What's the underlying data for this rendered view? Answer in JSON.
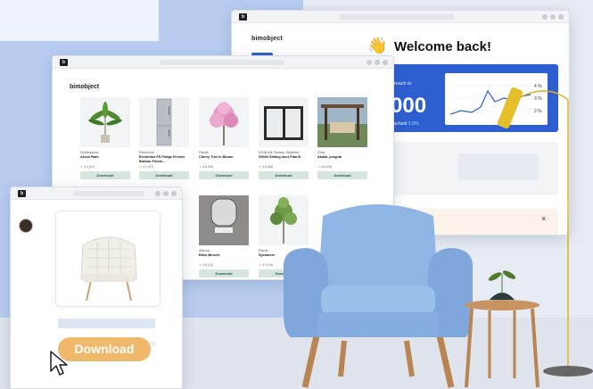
{
  "window_dashboard": {
    "logo": "bimobject",
    "greeting_emoji": "👋",
    "greeting": "Welcome back!",
    "stats": {
      "label": "al reach in",
      "value": "000",
      "sub_prefix": "reached ",
      "sub_pct": "3.8%"
    },
    "mini_chart_ticks": [
      "4 %",
      "3 %",
      "2 %"
    ],
    "close_icon": "×"
  },
  "window_catalog": {
    "logo": "bimobject",
    "products": [
      {
        "brand": "Gohleasons",
        "name": "Areca Palm",
        "rating": "4.2 (67)",
        "download": "Download",
        "thumb": "palm"
      },
      {
        "brand": "Electrolux",
        "name": "Electrolux FS Fridge Freezer Bottom Freeze...",
        "rating": "4.1 (67)",
        "download": "Download",
        "thumb": "fridge"
      },
      {
        "brand": "Plants",
        "name": "Cherry Tree in Bloom",
        "rating": "4.8 (53)",
        "download": "Download",
        "thumb": "cherry"
      },
      {
        "brand": "GEALAN Fenster-Systeme",
        "name": "S9000 Sliding door Plan B",
        "rating": "4.6 (66)",
        "download": "Download",
        "thumb": "door"
      },
      {
        "brand": "Gola",
        "name": "Akalla_pergola",
        "rating": "4.8 (29)",
        "download": "Download",
        "thumb": "pergola"
      },
      {
        "brand": "Alterna",
        "name": "Bliss Mirrors",
        "rating": "4.5 (12)",
        "download": "Download",
        "thumb": "mirror"
      },
      {
        "brand": "Plants",
        "name": "Sycamore",
        "rating": "4.9 (19)",
        "download": "Download",
        "thumb": "tree"
      }
    ]
  },
  "window_product": {
    "download_button": "Download"
  },
  "colors": {
    "accent_blue": "#2d5fd0",
    "download_orange": "#f0b86a",
    "download_green_bg": "#d6e6de",
    "star": "#f0a830"
  }
}
